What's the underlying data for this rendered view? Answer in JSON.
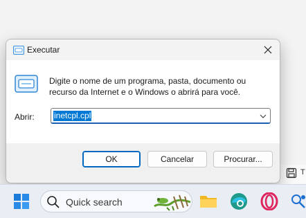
{
  "dialog": {
    "title": "Executar",
    "description": "Digite o nome de um programa, pasta, documento ou recurso da Internet e o Windows o abrirá para você.",
    "open_label": "Abrir:",
    "open_value": "inetcpl.cpl",
    "buttons": {
      "ok": "OK",
      "cancel": "Cancelar",
      "browse": "Procurar..."
    }
  },
  "background_app": {
    "partial_text": "T"
  },
  "taskbar": {
    "search_placeholder": "Quick search",
    "icons": [
      "windows-start-icon",
      "search-icon",
      "file-explorer-icon",
      "edge-icon",
      "opera-icon",
      "app-icon"
    ]
  },
  "colors": {
    "accent": "#0067c0",
    "selection": "#0078d4"
  }
}
